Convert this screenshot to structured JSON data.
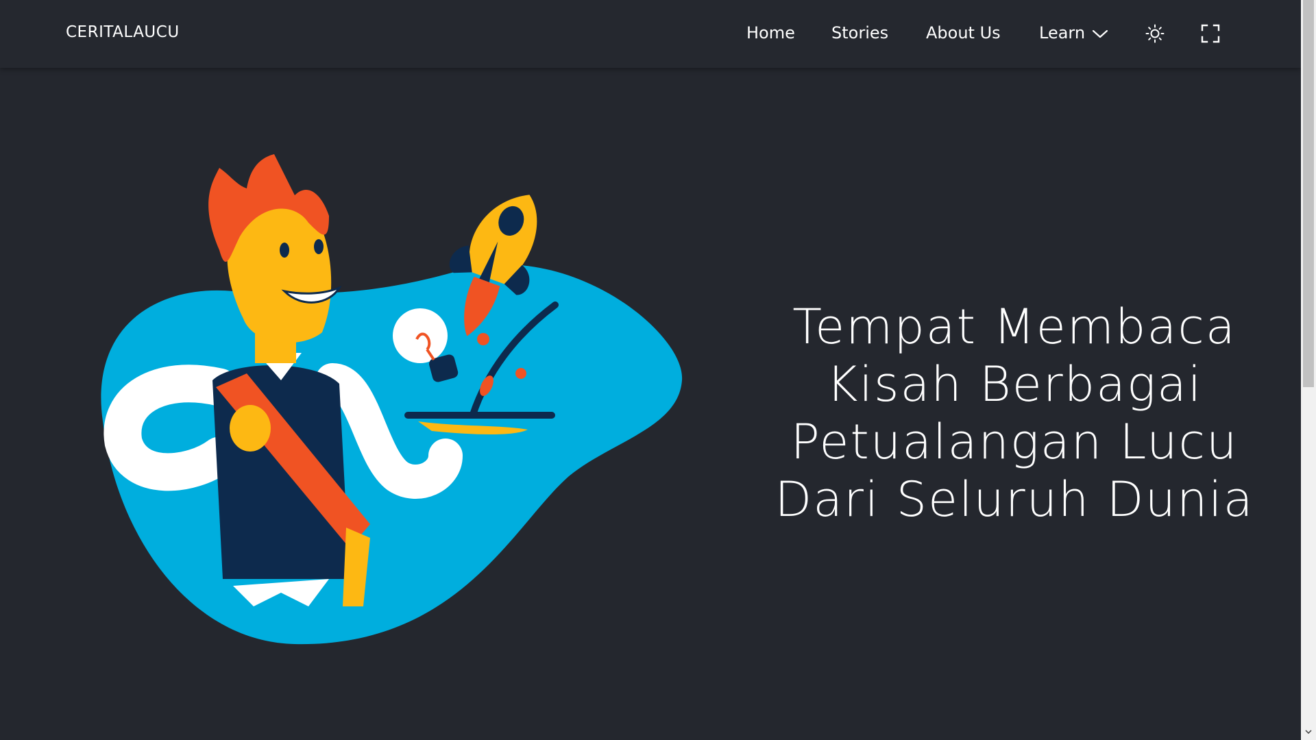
{
  "brand": {
    "name": "CERITALAUCU"
  },
  "nav": {
    "items": [
      {
        "label": "Home"
      },
      {
        "label": "Stories"
      },
      {
        "label": "About Us"
      },
      {
        "label": "Learn"
      }
    ],
    "learn_dropdown_icon": "chevron-down-icon",
    "theme_icon": "sun-icon",
    "fullscreen_icon": "fullscreen-icon"
  },
  "hero": {
    "title": "Tempat Membaca Kisah Berbagai Petualangan Lucu Dari Seluruh Dunia",
    "illustration": "man-with-rocket-laptop-illustration"
  },
  "colors": {
    "background": "#24272e",
    "blob": "#00aede",
    "accent_orange": "#f05323",
    "accent_yellow": "#fdb813",
    "navy": "#0d2a4d"
  }
}
